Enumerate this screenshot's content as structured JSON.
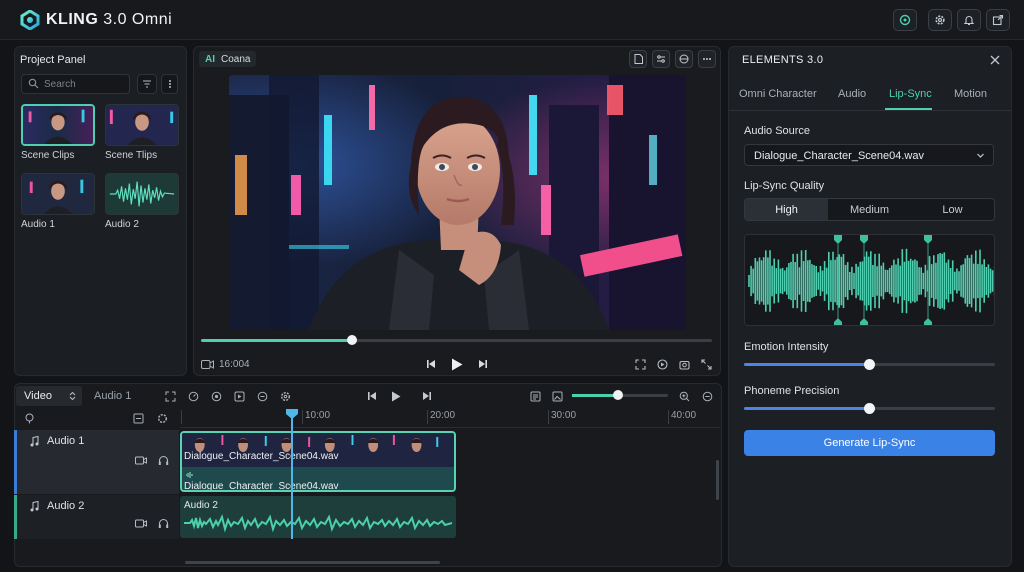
{
  "app": {
    "brand": "KLING",
    "version": "3.0 Omni"
  },
  "project_panel": {
    "title": "Project Panel",
    "search_placeholder": "Search",
    "items": [
      {
        "label": "Scene Clips"
      },
      {
        "label": "Scene Tlips"
      },
      {
        "label": "Audio 1"
      },
      {
        "label": "Audio 2"
      }
    ]
  },
  "viewer": {
    "ai_tag": "AI",
    "ai_tag_text": "Coana",
    "timecode": "16:004",
    "scrub_progress": 0.296
  },
  "timeline": {
    "tabs": {
      "video": "Video",
      "audio": "Audio 1"
    },
    "ruler_labels": [
      "10:00",
      "20:00",
      "30:00",
      "40:00"
    ],
    "zoom_level": 0.48,
    "tracks": [
      {
        "name": "Audio 1"
      },
      {
        "name": "Audio 2"
      }
    ],
    "clip1_video_label": "Dialogue_Character_Scene04.wav",
    "clip1_audio_label": "Dialogue_Character_Scene04.wav",
    "clip2_label": "Audio 2"
  },
  "elements": {
    "title": "ELEMENTS 3.0",
    "tabs": [
      "Omni Character",
      "Audio",
      "Lip-Sync",
      "Motion"
    ],
    "active_tab": "Lip-Sync",
    "audio_source_label": "Audio Source",
    "audio_source_value": "Dialogue_Character_Scene04.wav",
    "quality_label": "Lip-Sync Quality",
    "quality_options": [
      "High",
      "Medium",
      "Low"
    ],
    "quality_selected": "High",
    "emotion_label": "Emotion Intensity",
    "emotion_value": 0.5,
    "phoneme_label": "Phoneme Precision",
    "phoneme_value": 0.5,
    "generate_label": "Generate Lip-Sync"
  },
  "colors": {
    "accent": "#4ecfb0",
    "primary": "#3b82e6",
    "playhead": "#4fb8e8"
  }
}
